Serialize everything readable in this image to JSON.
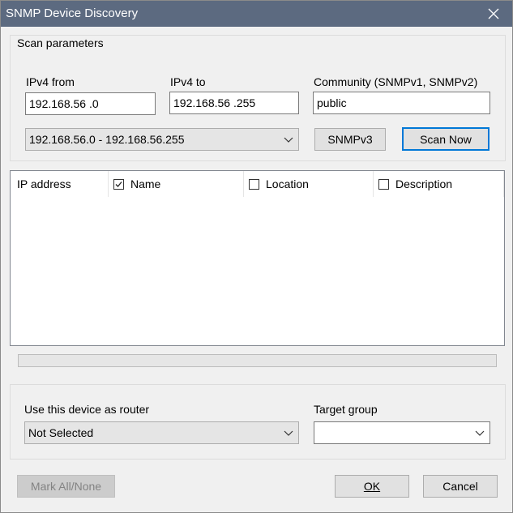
{
  "window": {
    "title": "SNMP Device Discovery"
  },
  "scan_params": {
    "group_title": "Scan parameters",
    "ipv4_from_label": "IPv4 from",
    "ipv4_from_value": "192.168.56 .0",
    "ipv4_to_label": "IPv4 to",
    "ipv4_to_value": "192.168.56 .255",
    "community_label": "Community (SNMPv1, SNMPv2)",
    "community_value": "public",
    "range_selected": "192.168.56.0 - 192.168.56.255",
    "snmpv3_label": "SNMPv3",
    "scan_now_label": "Scan Now"
  },
  "results": {
    "columns": [
      {
        "label": "IP address",
        "has_checkbox": false,
        "checked": false
      },
      {
        "label": "Name",
        "has_checkbox": true,
        "checked": true
      },
      {
        "label": "Location",
        "has_checkbox": true,
        "checked": false
      },
      {
        "label": "Description",
        "has_checkbox": true,
        "checked": false
      }
    ],
    "rows": [],
    "progress": 0
  },
  "router": {
    "label": "Use this device as router",
    "selected": "Not Selected",
    "target_group_label": "Target group",
    "target_group_selected": ""
  },
  "footer": {
    "mark_all_label": "Mark All/None",
    "ok_label": "OK",
    "cancel_label": "Cancel"
  },
  "colors": {
    "titlebar": "#5c6a80",
    "default_button_border": "#0078d7"
  },
  "icons": {
    "close": "close-icon",
    "dropdown": "chevron-down-icon",
    "checkbox": "checkbox-icon"
  }
}
